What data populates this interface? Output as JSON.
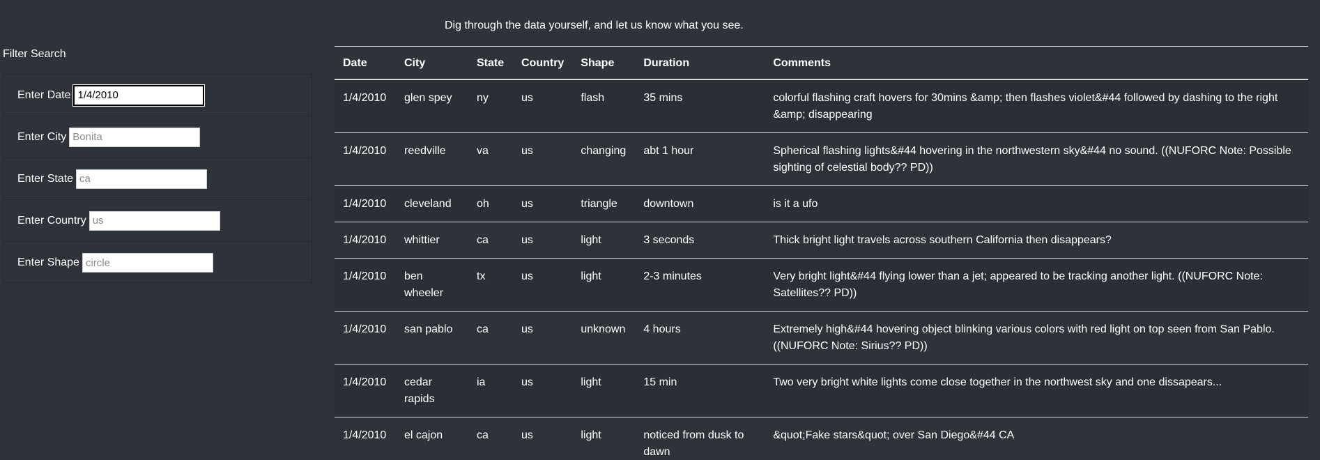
{
  "intro": "Dig through the data yourself, and let us know what you see.",
  "filter": {
    "title": "Filter Search",
    "fields": [
      {
        "label": "Enter Date",
        "value": "1/4/2010",
        "placeholder": ""
      },
      {
        "label": "Enter City",
        "value": "",
        "placeholder": "Bonita"
      },
      {
        "label": "Enter State",
        "value": "",
        "placeholder": "ca"
      },
      {
        "label": "Enter Country",
        "value": "",
        "placeholder": "us"
      },
      {
        "label": "Enter Shape",
        "value": "",
        "placeholder": "circle"
      }
    ]
  },
  "table": {
    "headers": [
      "Date",
      "City",
      "State",
      "Country",
      "Shape",
      "Duration",
      "Comments"
    ],
    "rows": [
      [
        "1/4/2010",
        "glen spey",
        "ny",
        "us",
        "flash",
        "35 mins",
        "colorful flashing craft hovers for 30mins &amp; then flashes violet&#44 followed by dashing to the right &amp; disappearing"
      ],
      [
        "1/4/2010",
        "reedville",
        "va",
        "us",
        "changing",
        "abt 1 hour",
        "Spherical flashing lights&#44 hovering in the northwestern sky&#44 no sound. ((NUFORC Note: Possible sighting of celestial body?? PD))"
      ],
      [
        "1/4/2010",
        "cleveland",
        "oh",
        "us",
        "triangle",
        "downtown",
        "is it a ufo"
      ],
      [
        "1/4/2010",
        "whittier",
        "ca",
        "us",
        "light",
        "3 seconds",
        "Thick bright light travels across southern California then disappears?"
      ],
      [
        "1/4/2010",
        "ben wheeler",
        "tx",
        "us",
        "light",
        "2-3 minutes",
        "Very bright light&#44 flying lower than a jet; appeared to be tracking another light. ((NUFORC Note: Satellites?? PD))"
      ],
      [
        "1/4/2010",
        "san pablo",
        "ca",
        "us",
        "unknown",
        "4 hours",
        "Extremely high&#44 hovering object blinking various colors with red light on top seen from San Pablo. ((NUFORC Note: Sirius?? PD))"
      ],
      [
        "1/4/2010",
        "cedar rapids",
        "ia",
        "us",
        "light",
        "15 min",
        "Two very bright white lights come close together in the northwest sky and one dissapears..."
      ],
      [
        "1/4/2010",
        "el cajon",
        "ca",
        "us",
        "light",
        "noticed from dusk to dawn",
        "&quot;Fake stars&quot; over San Diego&#44 CA"
      ]
    ]
  }
}
